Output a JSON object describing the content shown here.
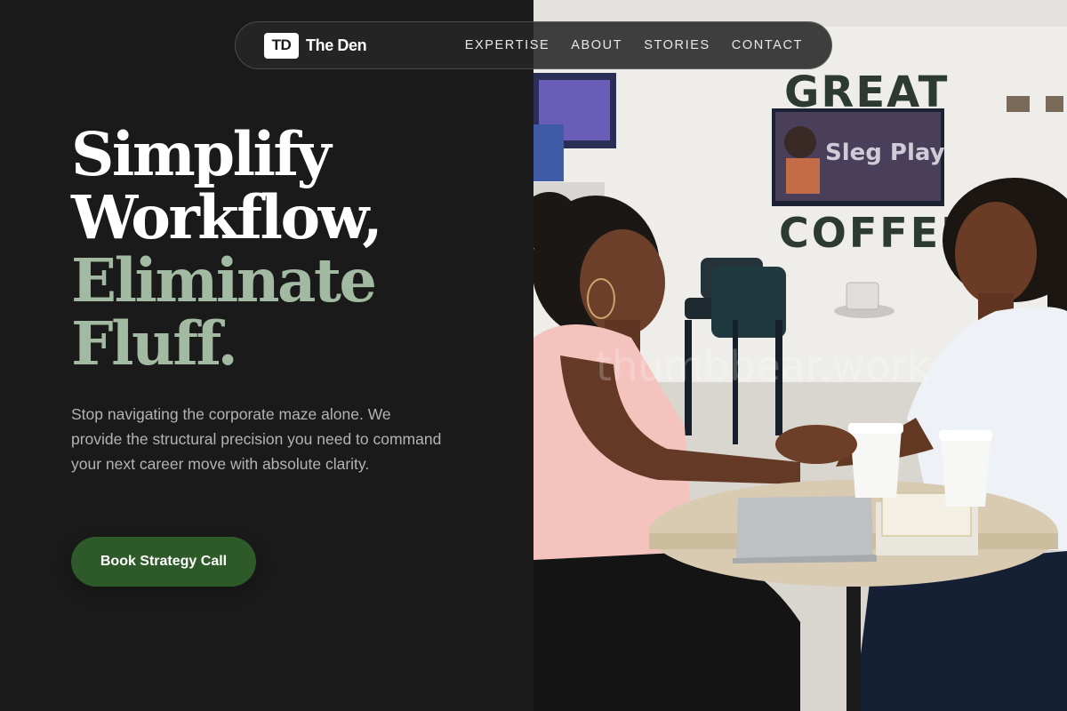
{
  "brand": {
    "mark": "TD",
    "name": "The Den"
  },
  "nav": {
    "items": [
      "EXPERTISE",
      "ABOUT",
      "STORIES",
      "CONTACT"
    ]
  },
  "hero": {
    "headline_lines": [
      "Simplify",
      "Workflow,",
      "Eliminate",
      "Fluff."
    ],
    "subtext": "Stop navigating the corporate maze alone. We provide the structural precision you need to command your next career move with absolute clarity.",
    "cta_label": "Book Strategy Call"
  },
  "photo": {
    "wall_sign_top": "GREAT",
    "wall_sign_bottom": "COFFEE",
    "tv_text": "Sleg Play",
    "watermark": "thumbbear.work"
  },
  "colors": {
    "background": "#1a1a1a",
    "accent_sage": "#a2b9a2",
    "cta_green": "#2e5a2a"
  }
}
